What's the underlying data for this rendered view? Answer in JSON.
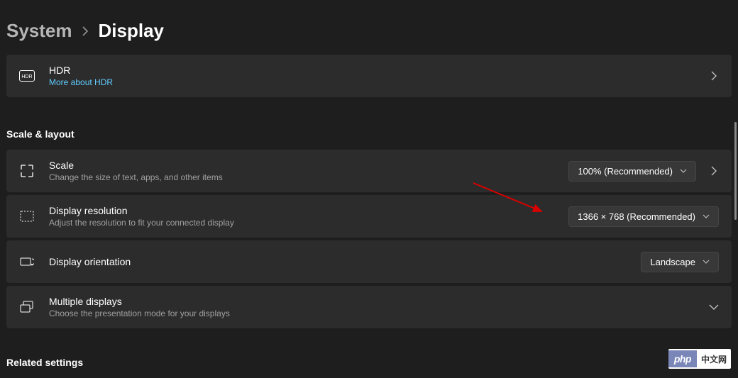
{
  "breadcrumb": {
    "parent": "System",
    "current": "Display"
  },
  "hdr": {
    "title": "HDR",
    "link": "More about HDR"
  },
  "sections": {
    "scale_layout": "Scale & layout",
    "related": "Related settings"
  },
  "scale": {
    "title": "Scale",
    "sub": "Change the size of text, apps, and other items",
    "value": "100% (Recommended)"
  },
  "resolution": {
    "title": "Display resolution",
    "sub": "Adjust the resolution to fit your connected display",
    "value": "1366 × 768 (Recommended)"
  },
  "orientation": {
    "title": "Display orientation",
    "value": "Landscape"
  },
  "multiple": {
    "title": "Multiple displays",
    "sub": "Choose the presentation mode for your displays"
  },
  "watermark": {
    "logo": "php",
    "cn": "中文网"
  }
}
